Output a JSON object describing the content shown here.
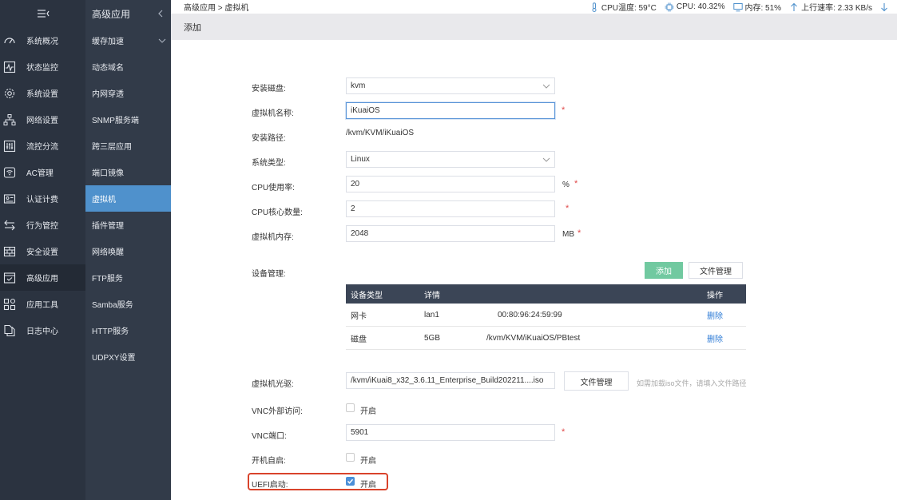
{
  "nav1": {
    "items": [
      {
        "label": "系统概况",
        "icon": "gauge-icon"
      },
      {
        "label": "状态监控",
        "icon": "pulse-icon"
      },
      {
        "label": "系统设置",
        "icon": "gear-icon"
      },
      {
        "label": "网络设置",
        "icon": "network-icon"
      },
      {
        "label": "流控分流",
        "icon": "sliders-icon"
      },
      {
        "label": "AC管理",
        "icon": "wifi-icon"
      },
      {
        "label": "认证计费",
        "icon": "id-card-icon"
      },
      {
        "label": "行为管控",
        "icon": "swap-icon"
      },
      {
        "label": "安全设置",
        "icon": "firewall-icon"
      },
      {
        "label": "高级应用",
        "icon": "check-window-icon"
      },
      {
        "label": "应用工具",
        "icon": "apps-icon"
      },
      {
        "label": "日志中心",
        "icon": "docs-icon"
      }
    ]
  },
  "nav2": {
    "title": "高级应用",
    "items": [
      {
        "label": "缓存加速"
      },
      {
        "label": "动态域名"
      },
      {
        "label": "内网穿透"
      },
      {
        "label": "SNMP服务端"
      },
      {
        "label": "跨三层应用"
      },
      {
        "label": "端口镜像"
      },
      {
        "label": "虚拟机"
      },
      {
        "label": "插件管理"
      },
      {
        "label": "网络唤醒"
      },
      {
        "label": "FTP服务"
      },
      {
        "label": "Samba服务"
      },
      {
        "label": "HTTP服务"
      },
      {
        "label": "UDPXY设置"
      }
    ]
  },
  "topbar": {
    "breadcrumb": "高级应用 > 虚拟机",
    "cpu_temp": "CPU温度: 59°C",
    "cpu": "CPU: 40.32%",
    "memory": "内存: 51%",
    "upload": "上行速率: 2.33 KB/s"
  },
  "subbar": {
    "title": "添加"
  },
  "form": {
    "disk_label": "安装磁盘:",
    "disk_value": "kvm",
    "name_label": "虚拟机名称:",
    "name_value": "iKuaiOS",
    "path_label": "安装路径:",
    "path_value": "/kvm/KVM/iKuaiOS",
    "os_label": "系统类型:",
    "os_value": "Linux",
    "cpu_usage_label": "CPU使用率:",
    "cpu_usage_value": "20",
    "cpu_usage_unit": "%",
    "cpu_cores_label": "CPU核心数量:",
    "cpu_cores_value": "2",
    "mem_label": "虚拟机内存:",
    "mem_value": "2048",
    "mem_unit": "MB",
    "required_mark": "*",
    "device_label": "设备管理:",
    "add_button": "添加",
    "file_mgmt_button": "文件管理",
    "iso_label": "虚拟机光驱:",
    "iso_value": "/kvm/iKuai8_x32_3.6.11_Enterprise_Build202211....iso",
    "iso_file_button": "文件管理",
    "iso_hint": "如需加载iso文件，请填入文件路径",
    "vnc_ext_label": "VNC外部访问:",
    "vnc_ext_text": "开启",
    "vnc_port_label": "VNC端口:",
    "vnc_port_value": "5901",
    "autostart_label": "开机自启:",
    "autostart_text": "开启",
    "uefi_label": "UEFI启动:",
    "uefi_text": "开启"
  },
  "device_table": {
    "headers": {
      "type": "设备类型",
      "detail": "详情",
      "action": "操作"
    },
    "rows": [
      {
        "type": "网卡",
        "detail1": "lan1",
        "detail2": "00:80:96:24:59:99",
        "action": "删除"
      },
      {
        "type": "磁盘",
        "detail1": "5GB",
        "detail2": "/kvm/KVM/iKuaiOS/PBtest",
        "action": "删除"
      }
    ]
  },
  "colors": {
    "accent": "#4f91cc",
    "sidebar": "#2b3340",
    "green": "#71c9a0",
    "required": "#e04848",
    "highlight": "#d9432b"
  }
}
